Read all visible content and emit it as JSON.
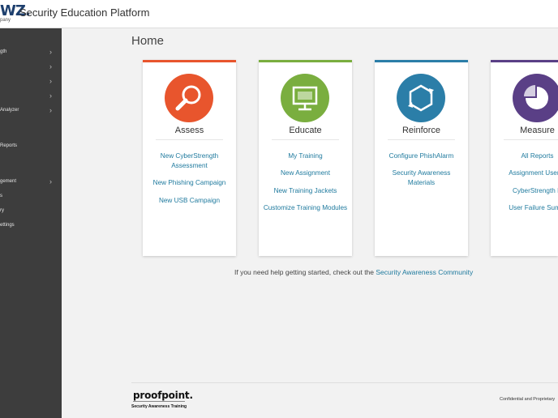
{
  "header": {
    "logo_mark": "WZ.",
    "logo_sub": "pany",
    "title": "Security Education Platform"
  },
  "sidebar": {
    "items": [
      {
        "label": "gth",
        "chevron": "›"
      },
      {
        "label": "",
        "chevron": "›"
      },
      {
        "label": "",
        "chevron": "›"
      },
      {
        "label": "",
        "chevron": "›"
      },
      {
        "label": "Analyzer",
        "chevron": "›"
      },
      {
        "label": "Reports",
        "chevron": ""
      },
      {
        "label": "gement",
        "chevron": "›"
      },
      {
        "label": "s",
        "chevron": ""
      },
      {
        "label": "ry",
        "chevron": ""
      },
      {
        "label": "ettings",
        "chevron": ""
      }
    ]
  },
  "main": {
    "title": "Home",
    "cards": [
      {
        "title": "Assess",
        "accent": "#e8552d",
        "icon": "magnifier-icon",
        "links": [
          "New CyberStrength Assessment",
          "New Phishing Campaign",
          "New USB Campaign"
        ]
      },
      {
        "title": "Educate",
        "accent": "#7aae3f",
        "icon": "monitor-icon",
        "links": [
          "My Training",
          "New Assignment",
          "New Training Jackets",
          "Customize Training Modules"
        ]
      },
      {
        "title": "Reinforce",
        "accent": "#2b7ea8",
        "icon": "cycle-arrows-icon",
        "links": [
          "Configure PhishAlarm",
          "Security Awareness Materials"
        ]
      },
      {
        "title": "Measure",
        "accent": "#5a3f86",
        "icon": "pie-chart-icon",
        "links": [
          "All Reports",
          "Assignment User D",
          "CyberStrength R",
          "User Failure Summ"
        ]
      }
    ],
    "help_text": "If you need help getting started, check out the ",
    "help_link": "Security Awareness Community"
  },
  "footer": {
    "brand": "proofpoint.",
    "tagline": "Security Awareness Training",
    "confidential": "Confidential and Proprietary"
  }
}
